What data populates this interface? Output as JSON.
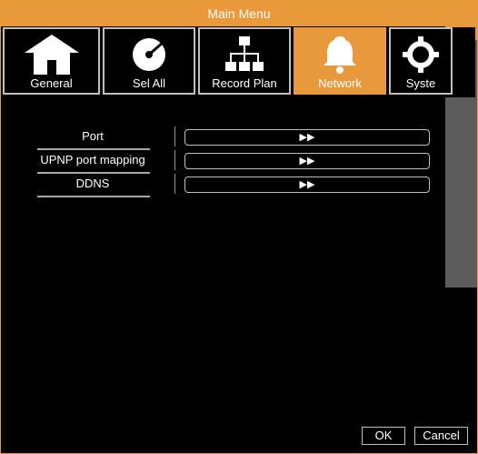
{
  "window": {
    "title": "Main Menu"
  },
  "tabs": [
    {
      "label": "General",
      "icon": "home-icon",
      "active": false
    },
    {
      "label": "Sel All",
      "icon": "disc-icon",
      "active": false
    },
    {
      "label": "Record Plan",
      "icon": "hierarchy-icon",
      "active": false
    },
    {
      "label": "Network",
      "icon": "bell-icon",
      "active": true
    },
    {
      "label": "Syste",
      "icon": "gear-icon",
      "active": false
    }
  ],
  "settings": {
    "items": [
      {
        "label": "Port",
        "button": "▶▶"
      },
      {
        "label": "UPNP port mapping",
        "button": "▶▶"
      },
      {
        "label": "DDNS",
        "button": "▶▶"
      }
    ]
  },
  "footer": {
    "ok_label": "OK",
    "cancel_label": "Cancel"
  },
  "colors": {
    "accent": "#e8993b",
    "background": "#000000",
    "border": "#bfbfbf"
  }
}
